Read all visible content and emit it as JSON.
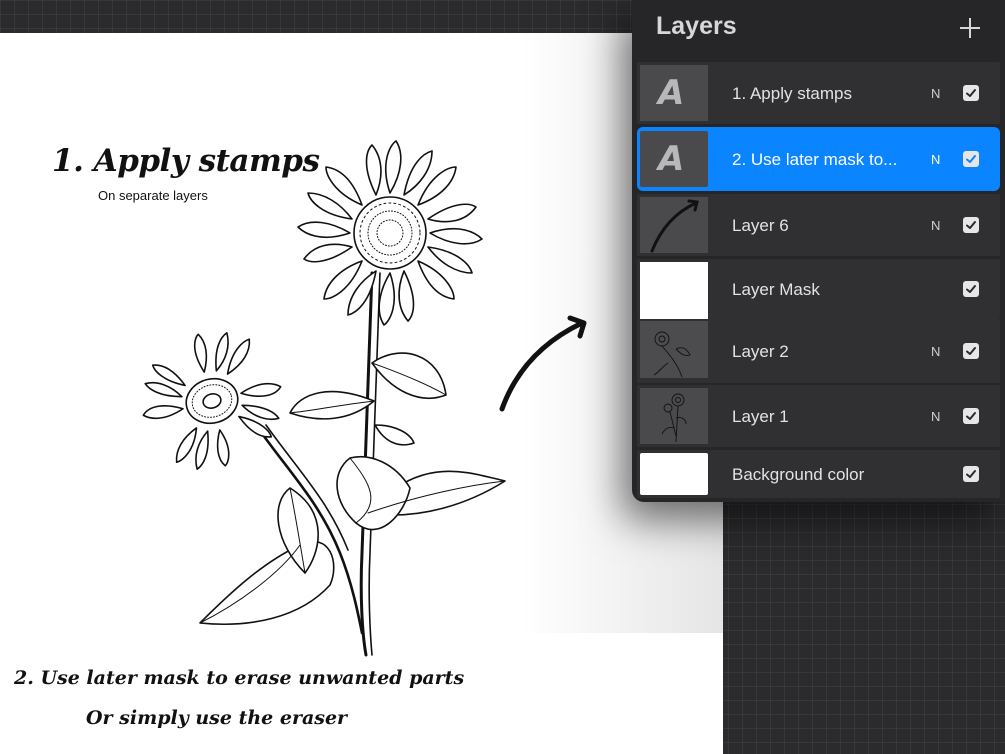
{
  "canvas": {
    "title": "1. Apply stamps",
    "subtitle": "On separate layers",
    "caption_mask": "2. Use later mask to erase unwanted parts",
    "caption_eraser": "Or simply use the eraser"
  },
  "layers_panel": {
    "title": "Layers",
    "add_icon": "plus-icon",
    "items": [
      {
        "name": "1. Apply stamps",
        "blend": "N",
        "visible": true,
        "thumbnail": "text-a-icon",
        "selected": false
      },
      {
        "name": "2. Use later mask to...",
        "blend": "N",
        "visible": true,
        "thumbnail": "text-a-icon",
        "selected": true
      },
      {
        "name": "Layer 6",
        "blend": "N",
        "visible": true,
        "thumbnail": "arrow-stroke",
        "selected": false
      },
      {
        "name": "Layer Mask",
        "blend": "",
        "visible": true,
        "thumbnail": "white-fill",
        "selected": false
      },
      {
        "name": "Layer 2",
        "blend": "N",
        "visible": true,
        "thumbnail": "sunflower-sketch",
        "selected": false
      },
      {
        "name": "Layer 1",
        "blend": "N",
        "visible": true,
        "thumbnail": "sunflower-small",
        "selected": false
      },
      {
        "name": "Background color",
        "blend": "",
        "visible": true,
        "thumbnail": "white-fill",
        "selected": false
      }
    ]
  },
  "colors": {
    "accent": "#0a84ff",
    "panel": "#262628",
    "row": "#303032"
  }
}
